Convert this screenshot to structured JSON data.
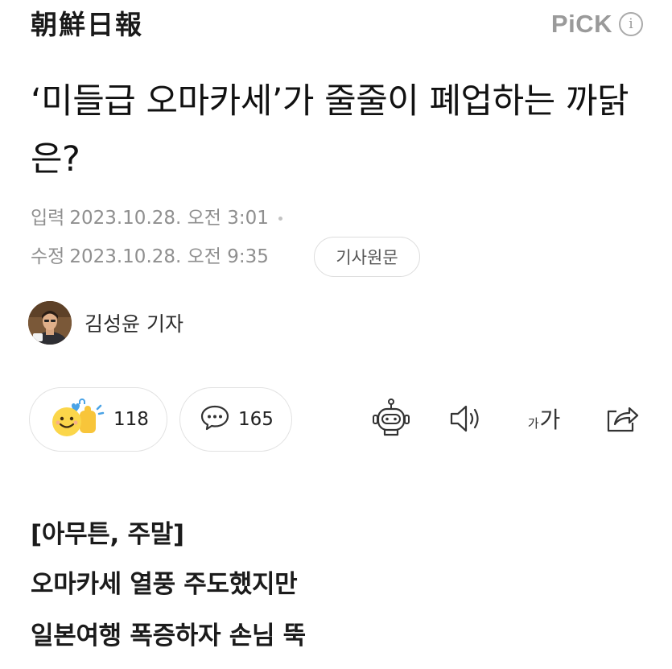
{
  "header": {
    "logo_text": "朝鮮日報",
    "pick_label": "PiCK",
    "info_glyph": "i"
  },
  "article": {
    "headline": "‘미들급 오마카세’가 줄줄이 폐업하는 까닭은?",
    "published": {
      "label": "입력",
      "value": "2023.10.28. 오전 3:01"
    },
    "modified": {
      "label": "수정",
      "value": "2023.10.28. 오전 9:35"
    },
    "original_button": "기사원문",
    "author": "김성윤 기자"
  },
  "actions": {
    "reaction_count": "118",
    "comment_count": "165",
    "font_small": "가",
    "font_large": "가"
  },
  "body": {
    "subheads": [
      "[아무튼, 주말]",
      "오마카세 열풍 주도했지만",
      "일본여행 폭증하자 손님 뚝"
    ]
  },
  "icons": {
    "reaction": "reaction-emoji-icon",
    "comment": "speech-bubble-icon",
    "summary": "robot-icon",
    "tts": "speaker-icon",
    "font": "font-size-icon",
    "share": "share-icon"
  }
}
